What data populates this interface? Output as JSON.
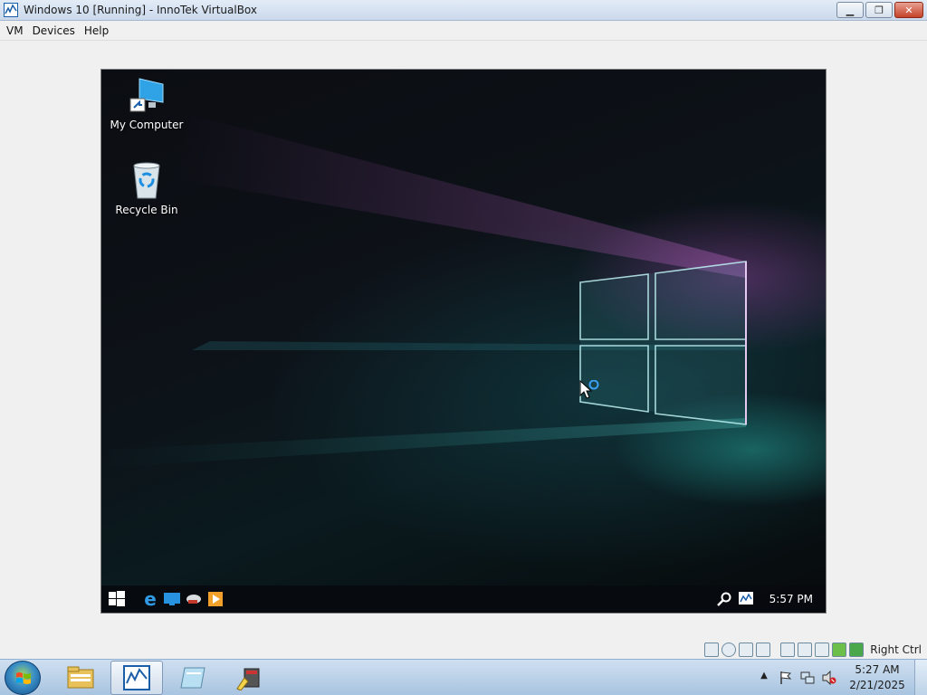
{
  "window": {
    "title": "Windows 10 [Running] - InnoTek VirtualBox",
    "buttons": [
      "minimize",
      "restore",
      "close"
    ]
  },
  "menu": {
    "items": [
      {
        "label": "VM"
      },
      {
        "label": "Devices"
      },
      {
        "label": "Help"
      }
    ]
  },
  "guest": {
    "desktop_icons": [
      {
        "label": "My Computer",
        "icon": "monitor-shortcut-icon"
      },
      {
        "label": "Recycle Bin",
        "icon": "recycle-bin-icon"
      }
    ],
    "taskbar": {
      "pinned": [
        "edge-icon",
        "desktop-icon",
        "cloud-icon",
        "media-player-icon"
      ],
      "tray": [
        "search-icon",
        "monitor-icon"
      ],
      "clock": "5:57 PM"
    }
  },
  "statusbar": {
    "host_key": "Right Ctrl",
    "icons": [
      "hard-disk-icon",
      "cd-icon",
      "floppy-icon",
      "network-icon",
      "usb-icon",
      "shared-folder-icon",
      "display-icon",
      "mouse-integration-icon",
      "capture-icon"
    ]
  },
  "host_taskbar": {
    "apps": [
      "file-explorer-icon",
      "virtualbox-icon",
      "notepad-icon",
      "tool-icon"
    ],
    "active_app": "virtualbox-icon",
    "tray": [
      "show-hidden-icon",
      "action-center-flag-icon",
      "network-icon",
      "volume-muted-icon"
    ],
    "clock_time": "5:27 AM",
    "clock_date": "2/21/2025"
  },
  "colors": {
    "titlebar": "#cad9ec",
    "taskbar": "#a9c4e0",
    "guest_bg": "#0b0d12",
    "accent_cyan": "#2bb7b0",
    "accent_magenta": "#be50c8"
  }
}
